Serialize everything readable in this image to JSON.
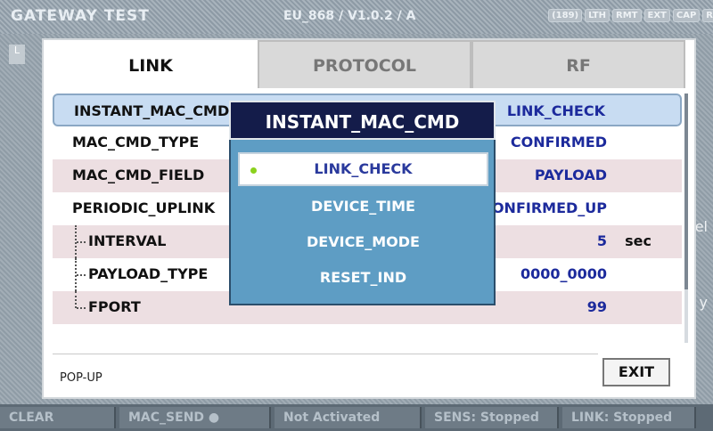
{
  "header": {
    "app_title": "GATEWAY TEST",
    "version": "EU_868 / V1.0.2 / A",
    "indicators": [
      "(189)",
      "LTH",
      "RMT",
      "EXT",
      "CAP",
      "R"
    ]
  },
  "status_bar": {
    "items": [
      "CLEAR",
      "MAC_SEND ●",
      "Not Activated",
      "SENS: Stopped",
      "LINK: Stopped"
    ]
  },
  "dialog": {
    "tabs": [
      "LINK",
      "PROTOCOL",
      "RF"
    ],
    "active_tab": "LINK",
    "rows": [
      {
        "label": "INSTANT_MAC_CMD",
        "value": "LINK_CHECK",
        "unit": ""
      },
      {
        "label": "MAC_CMD_TYPE",
        "value": "CONFIRMED",
        "unit": ""
      },
      {
        "label": "MAC_CMD_FIELD",
        "value": "PAYLOAD",
        "unit": ""
      },
      {
        "label": "PERIODIC_UPLINK",
        "value": "CONFIRMED_UP",
        "unit": ""
      },
      {
        "label": "INTERVAL",
        "value": "5",
        "unit": "sec"
      },
      {
        "label": "PAYLOAD_TYPE",
        "value": "0000_0000",
        "unit": ""
      },
      {
        "label": "FPORT",
        "value": "99",
        "unit": ""
      }
    ],
    "footer_text": "POP-UP",
    "exit_label": "EXIT"
  },
  "popup": {
    "title": "INSTANT_MAC_CMD",
    "options": [
      "LINK_CHECK",
      "DEVICE_TIME",
      "DEVICE_MODE",
      "RESET_IND"
    ],
    "selected": "LINK_CHECK"
  },
  "background": {
    "side_label": "L",
    "edge_hint_1": "el",
    "edge_hint_2": "y"
  }
}
